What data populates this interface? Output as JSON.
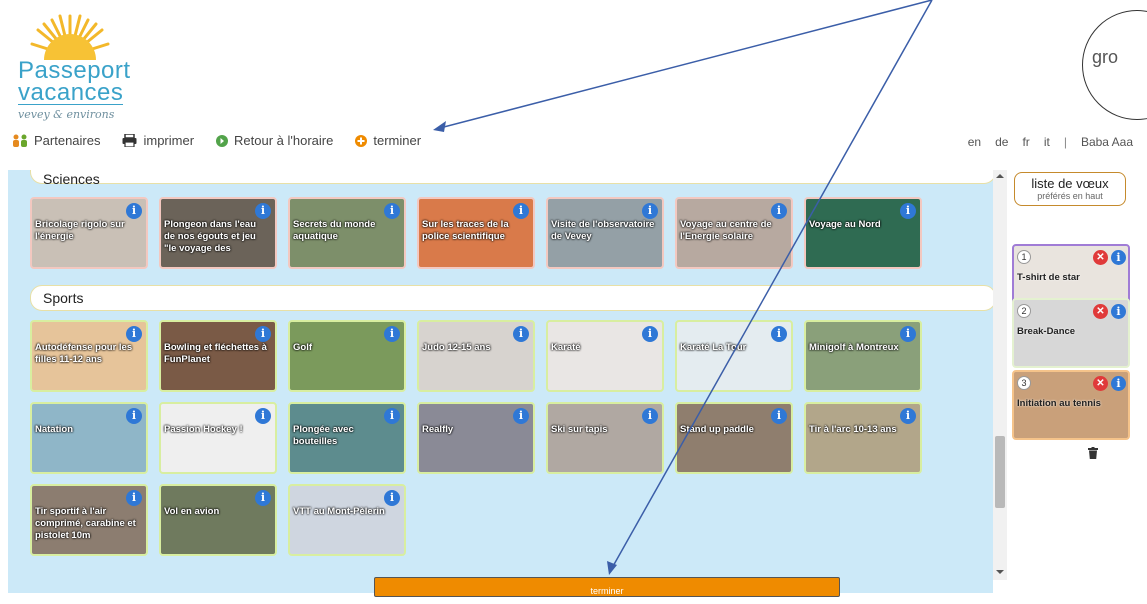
{
  "header": {
    "logo": {
      "line1": "Passeport",
      "line2": "vacances",
      "line3": "vevey & environs"
    },
    "groupe_logo_text": "gro",
    "toolbar": {
      "partenaires": "Partenaires",
      "imprimer": "imprimer",
      "retour": "Retour à l'horaire",
      "terminer": "terminer"
    },
    "languages": [
      "en",
      "de",
      "fr",
      "it"
    ],
    "separator": "|",
    "user": "Baba Aaa"
  },
  "categories": {
    "sciences": "Sciences",
    "sports": "Sports"
  },
  "sciences_activities": [
    {
      "title": "Bricolage rigolo sur l'énergie",
      "bg": "#c9c0b6"
    },
    {
      "title": "Plongeon dans l'eau de nos égouts et jeu \"le voyage des",
      "bg": "#6b6359"
    },
    {
      "title": "Secrets du monde aquatique",
      "bg": "#7d8f6a"
    },
    {
      "title": "Sur les traces de la police scientifique",
      "bg": "#d97a4a"
    },
    {
      "title": "Visite de l'observatoire de Vevey",
      "bg": "#94a0a6"
    },
    {
      "title": "Voyage au centre de l'Energie solaire",
      "bg": "#b7a9a0"
    },
    {
      "title": "Voyage au Nord",
      "bg": "#2f6b52"
    }
  ],
  "sports_activities": [
    {
      "title": "Autodéfense pour les filles 11-12 ans",
      "bg": "#e6c49a"
    },
    {
      "title": "Bowling et fléchettes à FunPlanet",
      "bg": "#7a5a46"
    },
    {
      "title": "Golf",
      "bg": "#7b9a5c"
    },
    {
      "title": "Judo 12-15 ans",
      "bg": "#d7d3cf"
    },
    {
      "title": "Karaté",
      "bg": "#e9e6e4"
    },
    {
      "title": "Karaté La Tour",
      "bg": "#e4ecf0"
    },
    {
      "title": "Minigolf à Montreux",
      "bg": "#8aa07a"
    },
    {
      "title": "Natation",
      "bg": "#8fb6c8"
    },
    {
      "title": "Passion Hockey !",
      "bg": "#efefef"
    },
    {
      "title": "Plongée avec bouteilles",
      "bg": "#5d8c8e"
    },
    {
      "title": "Realfly",
      "bg": "#8a8a96"
    },
    {
      "title": "Ski sur tapis",
      "bg": "#b0a8a2"
    },
    {
      "title": "Stand up paddle",
      "bg": "#8f7e6e"
    },
    {
      "title": "Tir à l'arc 10-13 ans",
      "bg": "#b2a68a"
    },
    {
      "title": "Tir sportif à l'air comprimé, carabine et pistolet 10m",
      "bg": "#8c7d70"
    },
    {
      "title": "Vol en avion",
      "bg": "#6f7a5e"
    },
    {
      "title": "VTT au Mont-Pèlerin",
      "bg": "#cfd6e0"
    }
  ],
  "wishlist": {
    "title": "liste de vœux",
    "subtitle": "préférés en haut",
    "items": [
      {
        "rank": "1",
        "title": "T-shirt de star",
        "bg": "#e9e4de",
        "border": "#a07cd6"
      },
      {
        "rank": "2",
        "title": "Break-Dance",
        "bg": "#d7d7d7",
        "border": "#e4f1d0"
      },
      {
        "rank": "3",
        "title": "Initiation au tennis",
        "bg": "#c9a07a",
        "border": "#f5c38a"
      }
    ]
  },
  "footer": {
    "terminer_button": "terminer"
  },
  "colors": {
    "panel_bg": "#cce9f8",
    "accent_orange": "#ef8b00",
    "info_blue": "#2f78d6",
    "annotation_line": "#3b5ea8"
  }
}
